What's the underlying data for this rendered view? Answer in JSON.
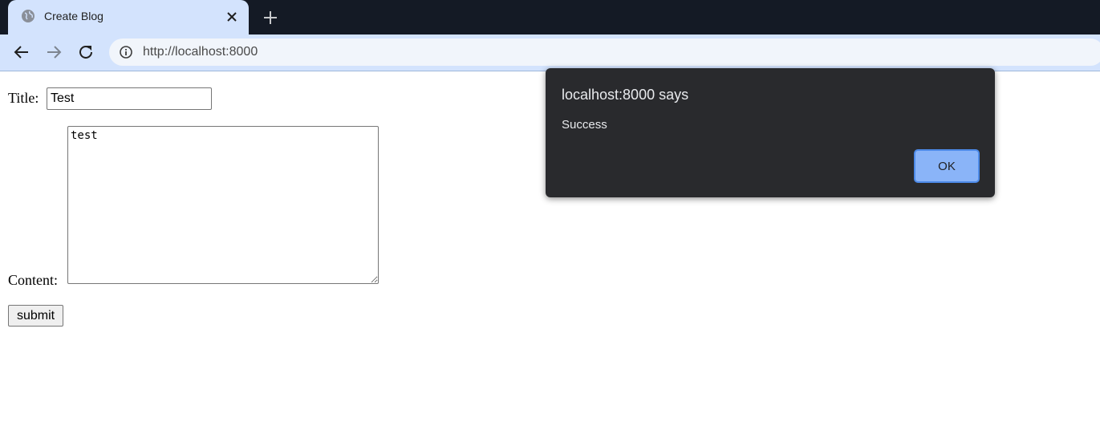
{
  "browser": {
    "tab": {
      "title": "Create Blog"
    },
    "omnibox": {
      "url": "http://localhost:8000"
    },
    "icons": {
      "favicon": "globe-icon",
      "close": "close-icon",
      "new_tab": "plus-icon",
      "back": "arrow-left-icon",
      "forward": "arrow-right-icon",
      "reload": "reload-icon",
      "site_info": "info-icon"
    },
    "colors": {
      "tabstrip": "#141a25",
      "active_tab": "#d3e3fd",
      "omnibox": "#f1f5fb"
    }
  },
  "form": {
    "title_label": "Title:",
    "title_value": "Test",
    "content_label": "Content:",
    "content_value": "test",
    "submit_label": "submit"
  },
  "dialog": {
    "title": "localhost:8000 says",
    "message": "Success",
    "ok_label": "OK",
    "colors": {
      "background": "#292a2d",
      "ok_button": "#8ab4f8"
    }
  }
}
